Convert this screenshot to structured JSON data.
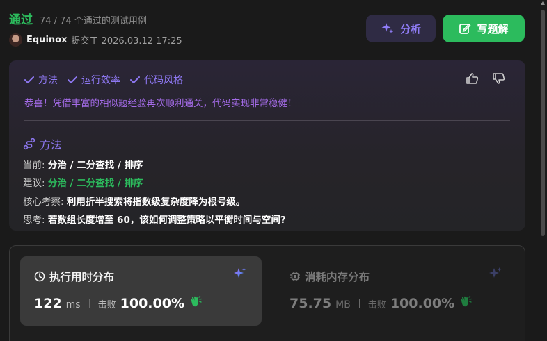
{
  "header": {
    "status": "通过",
    "test_summary": "74 / 74 个通过的测试用例",
    "author": "Equinox",
    "submitted": "提交于 2026.03.12 17:25",
    "analyze_label": "分析",
    "solution_label": "写题解"
  },
  "analysis": {
    "checks": [
      "方法",
      "运行效率",
      "代码风格"
    ],
    "congrats": "恭喜！凭借丰富的相似题经验再次顺利通关，代码实现非常稳健！",
    "method_title": "方法",
    "current_label": "当前:",
    "current_value": "分治 / 二分查找 / 排序",
    "suggest_label": "建议:",
    "suggest_value": "分治 / 二分查找 / 排序",
    "insight_label": "核心考察:",
    "insight_value": "利用折半搜索将指数级复杂度降为根号级。",
    "think_label": "思考:",
    "think_value": "若数组长度增至 60，该如何调整策略以平衡时间与空间?"
  },
  "performance": {
    "runtime": {
      "title": "执行用时分布",
      "value": "122",
      "unit": "ms",
      "beats_label": "击败",
      "beats_pct": "100.00%"
    },
    "memory": {
      "title": "消耗内存分布",
      "value": "75.75",
      "unit": "MB",
      "beats_label": "击败",
      "beats_pct": "100.00%"
    }
  },
  "colors": {
    "accept_green": "#2cbb5d",
    "purple_accent": "#8e78f2",
    "congrats_purple": "#a46be8"
  },
  "icons": [
    "check-icon",
    "thumbs-up-icon",
    "thumbs-down-icon",
    "sparkle-icon",
    "edit-icon",
    "method-icon",
    "clock-icon",
    "chip-icon",
    "clap-icon"
  ]
}
